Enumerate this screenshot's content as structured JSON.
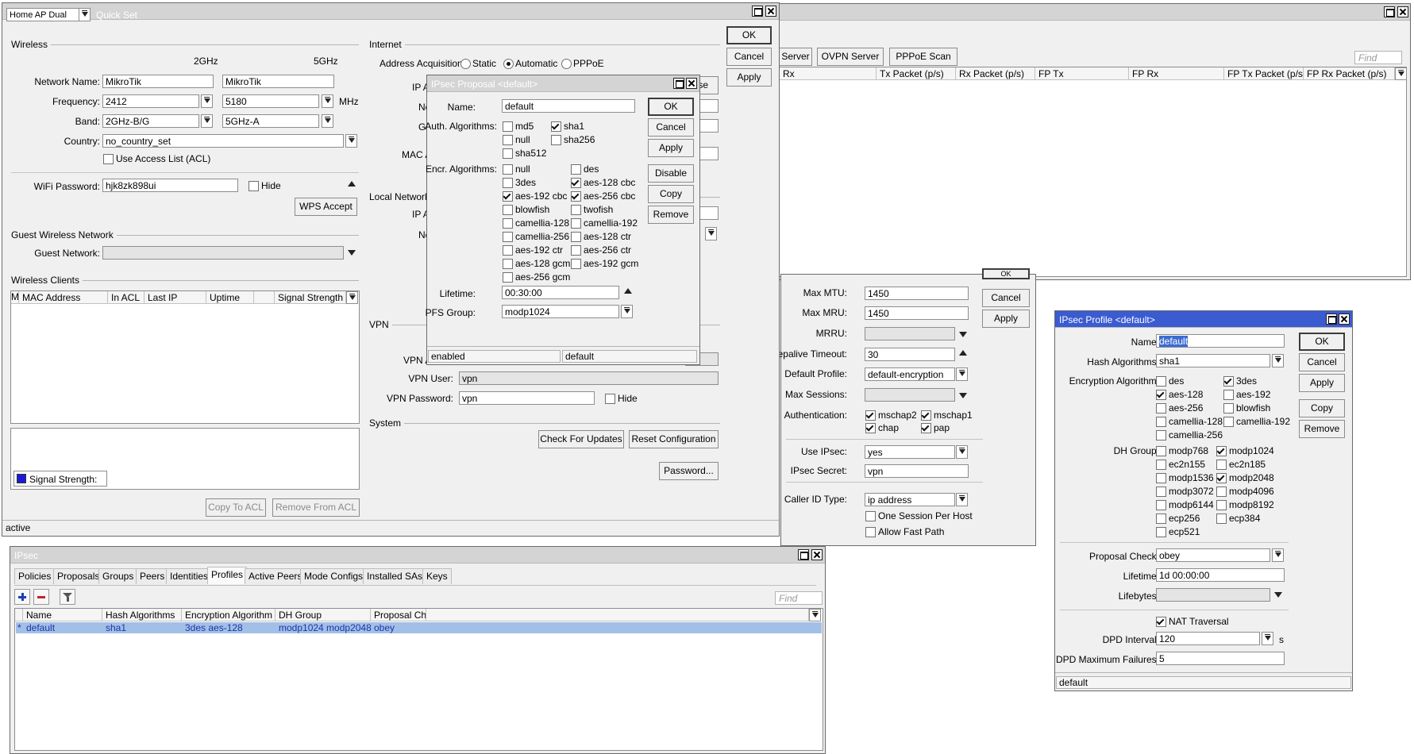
{
  "quickset": {
    "mode": "Home AP Dual",
    "title": "Quick Set",
    "buttons": {
      "ok": "OK",
      "cancel": "Cancel",
      "apply": "Apply"
    },
    "wireless": {
      "section": "Wireless",
      "col_2ghz": "2GHz",
      "col_5ghz": "5GHz",
      "network_name_label": "Network Name:",
      "network_name_2": "MikroTik",
      "network_name_5": "MikroTik",
      "frequency_label": "Frequency:",
      "frequency_2": "2412",
      "frequency_5": "5180",
      "mhz": "MHz",
      "band_label": "Band:",
      "band_2": "2GHz-B/G",
      "band_5": "5GHz-A",
      "country_label": "Country:",
      "country": "no_country_set",
      "use_acl": "Use Access List (ACL)",
      "wifi_password_label": "WiFi Password:",
      "wifi_password": "hjk8zk898ui",
      "hide": "Hide",
      "wps_accept": "WPS Accept"
    },
    "guest": {
      "section": "Guest Wireless Network",
      "guest_network_label": "Guest Network:"
    },
    "clients": {
      "section": "Wireless Clients",
      "columns": [
        "MAC Address",
        "In ACL",
        "Last IP",
        "Uptime",
        "Signal Strength"
      ],
      "signal_strength": "Signal Strength:",
      "copy_to_acl": "Copy To ACL",
      "remove_from_acl": "Remove From ACL"
    },
    "internet": {
      "section": "Internet",
      "address_acquisition": "Address Acquisition:",
      "static": "Static",
      "automatic": "Automatic",
      "pppoe": "PPPoE",
      "ip_label": "IP A",
      "netmask_label": "Ne",
      "gateway_label": "Ga",
      "mac_label": "MAC A",
      "release_tail": "se"
    },
    "local": {
      "section": "Local Network",
      "ip_label": "IP A",
      "netmask_label": "Ne"
    },
    "vpn": {
      "section": "VPN",
      "vpn_address_label": "VPN A",
      "vpn_user_label": "VPN User:",
      "vpn_user": "vpn",
      "vpn_password_label": "VPN Password:",
      "vpn_password": "vpn",
      "hide": "Hide"
    },
    "system": {
      "section": "System",
      "check_updates": "Check For Updates",
      "reset_configuration": "Reset Configuration",
      "password": "Password..."
    },
    "status": "active"
  },
  "interface_list": {
    "buttons": [
      "Server",
      "OVPN Server",
      "PPPoE Scan"
    ],
    "find": "Find",
    "columns": [
      "Rx",
      "Tx Packet (p/s)",
      "Rx Packet (p/s)",
      "FP Tx",
      "FP Rx",
      "FP Tx Packet (p/s)",
      "FP Rx Packet (p/s)"
    ]
  },
  "ppp_profile": {
    "ok_partial": "OK",
    "cancel": "Cancel",
    "apply": "Apply",
    "max_mtu_label": "Max MTU:",
    "max_mtu": "1450",
    "max_mru_label": "Max MRU:",
    "max_mru": "1450",
    "mrru_label": "MRRU:",
    "keepalive_label": "Keepalive Timeout:",
    "keepalive": "30",
    "default_profile_label": "Default Profile:",
    "default_profile": "default-encryption",
    "max_sessions_label": "Max Sessions:",
    "authentication_label": "Authentication:",
    "mschap2": "mschap2",
    "mschap1": "mschap1",
    "chap": "chap",
    "pap": "pap",
    "use_ipsec_label": "Use IPsec:",
    "use_ipsec": "yes",
    "ipsec_secret_label": "IPsec Secret:",
    "ipsec_secret": "vpn",
    "caller_id_label": "Caller ID Type:",
    "caller_id": "ip address",
    "one_session": "One Session Per Host",
    "allow_fast_path": "Allow Fast Path"
  },
  "proposal": {
    "title": "IPsec Proposal <default>",
    "name_label": "Name:",
    "name": "default",
    "auth_label": "Auth. Algorithms:",
    "auth": [
      "md5",
      "sha1",
      "null",
      "sha256",
      "sha512"
    ],
    "encr_label": "Encr. Algorithms:",
    "encr_left": [
      "null",
      "3des",
      "aes-192 cbc",
      "blowfish",
      "camellia-128",
      "camellia-256",
      "aes-192 ctr",
      "aes-128 gcm",
      "aes-256 gcm"
    ],
    "encr_right": [
      "des",
      "aes-128 cbc",
      "aes-256 cbc",
      "twofish",
      "camellia-192",
      "aes-128 ctr",
      "aes-256 ctr",
      "aes-192 gcm"
    ],
    "lifetime_label": "Lifetime:",
    "lifetime": "00:30:00",
    "pfs_label": "PFS Group:",
    "pfs": "modp1024",
    "buttons": {
      "ok": "OK",
      "cancel": "Cancel",
      "apply": "Apply",
      "disable": "Disable",
      "copy": "Copy",
      "remove": "Remove"
    },
    "status_left": "enabled",
    "status_right": "default"
  },
  "ipsec": {
    "title": "IPsec",
    "tabs": [
      "Policies",
      "Proposals",
      "Groups",
      "Peers",
      "Identities",
      "Profiles",
      "Active Peers",
      "Mode Configs",
      "Installed SAs",
      "Keys"
    ],
    "find": "Find",
    "columns": [
      "Name",
      "Hash Algorithms",
      "Encryption Algorithm",
      "DH Group",
      "Proposal Ch..."
    ],
    "row": {
      "marker": "*",
      "name": "default",
      "hash": "sha1",
      "encryption": "3des aes-128",
      "dh": "modp1024 modp2048",
      "proposal": "obey"
    }
  },
  "profile": {
    "title": "IPsec Profile <default>",
    "name_label": "Name:",
    "name": "default",
    "hash_label": "Hash Algorithms:",
    "hash": "sha1",
    "enc_label": "Encryption Algorithm:",
    "enc_left": [
      "des",
      "aes-128",
      "aes-256",
      "camellia-128",
      "camellia-256"
    ],
    "enc_right": [
      "3des",
      "aes-192",
      "blowfish",
      "camellia-192"
    ],
    "dh_label": "DH Group:",
    "dh_left": [
      "modp768",
      "ec2n155",
      "modp1536",
      "modp3072",
      "modp6144",
      "ecp256",
      "ecp521"
    ],
    "dh_right": [
      "modp1024",
      "ec2n185",
      "modp2048",
      "modp4096",
      "modp8192",
      "ecp384"
    ],
    "proposal_check_label": "Proposal Check:",
    "proposal_check": "obey",
    "lifetime_label": "Lifetime:",
    "lifetime": "1d 00:00:00",
    "lifebytes_label": "Lifebytes:",
    "nat_traversal": "NAT Traversal",
    "dpd_interval_label": "DPD Interval:",
    "dpd_interval": "120",
    "dpd_unit": "s",
    "dpd_max_label": "DPD Maximum Failures:",
    "dpd_max": "5",
    "buttons": {
      "ok": "OK",
      "cancel": "Cancel",
      "apply": "Apply",
      "copy": "Copy",
      "remove": "Remove"
    },
    "status": "default"
  }
}
